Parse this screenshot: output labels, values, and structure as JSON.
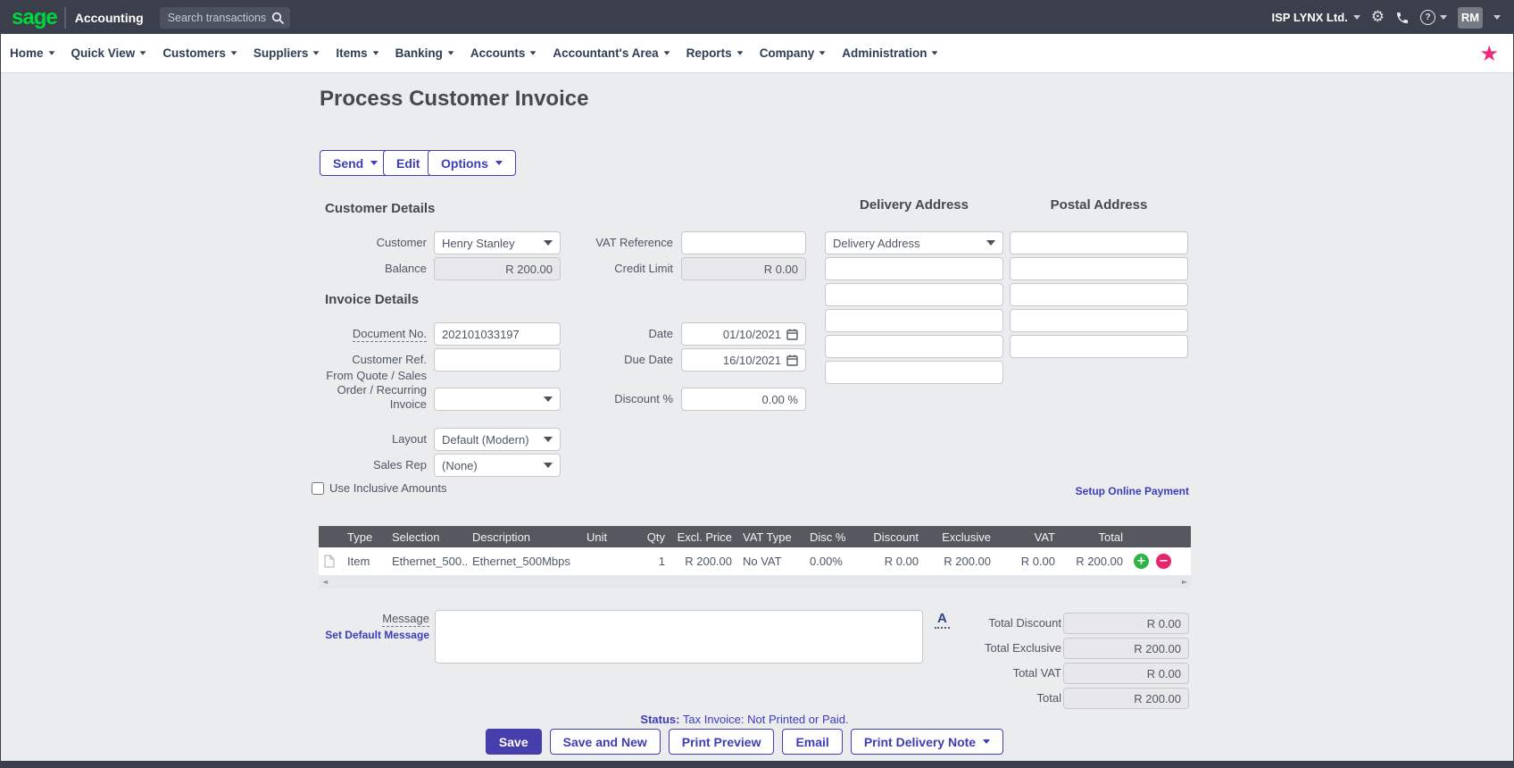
{
  "topbar": {
    "logo": "sage",
    "product": "Accounting",
    "search_placeholder": "Search transactions",
    "company": "ISP LYNX Ltd.",
    "user_initials": "RM"
  },
  "nav": {
    "items": [
      {
        "label": "Home"
      },
      {
        "label": "Quick View"
      },
      {
        "label": "Customers"
      },
      {
        "label": "Suppliers"
      },
      {
        "label": "Items"
      },
      {
        "label": "Banking"
      },
      {
        "label": "Accounts"
      },
      {
        "label": "Accountant's Area"
      },
      {
        "label": "Reports"
      },
      {
        "label": "Company"
      },
      {
        "label": "Administration"
      }
    ]
  },
  "page": {
    "title": "Process Customer Invoice"
  },
  "toolbar": {
    "send": "Send",
    "edit": "Edit",
    "options": "Options"
  },
  "customer_details": {
    "heading": "Customer Details",
    "customer_label": "Customer",
    "customer_value": "Henry Stanley",
    "balance_label": "Balance",
    "balance_value": "R 200.00",
    "vat_reference_label": "VAT Reference",
    "vat_reference_value": "",
    "credit_limit_label": "Credit Limit",
    "credit_limit_value": "R 0.00"
  },
  "addresses": {
    "delivery_heading": "Delivery Address",
    "postal_heading": "Postal Address",
    "delivery_type_value": "Delivery Address"
  },
  "invoice_details": {
    "heading": "Invoice Details",
    "document_no_label": "Document No.",
    "document_no_value": "202101033197",
    "customer_ref_label": "Customer Ref.",
    "customer_ref_value": "",
    "from_quote_label": "From Quote / Sales Order / Recurring Invoice",
    "from_quote_value": "",
    "layout_label": "Layout",
    "layout_value": "Default (Modern)",
    "sales_rep_label": "Sales Rep",
    "sales_rep_value": "(None)",
    "date_label": "Date",
    "date_value": "01/10/2021",
    "due_date_label": "Due Date",
    "due_date_value": "16/10/2021",
    "discount_label": "Discount %",
    "discount_value": "0.00 %"
  },
  "flags": {
    "use_inclusive_label": "Use Inclusive Amounts",
    "use_inclusive_checked": false,
    "setup_online_payment_link": "Setup Online Payment"
  },
  "line_items": {
    "columns": [
      "Type",
      "Selection",
      "Description",
      "Unit",
      "Qty",
      "Excl. Price",
      "VAT Type",
      "Disc %",
      "Discount",
      "Exclusive",
      "VAT",
      "Total"
    ],
    "rows": [
      {
        "type": "Item",
        "selection": "Ethernet_500...",
        "description": "Ethernet_500Mbps",
        "unit": "",
        "qty": "1",
        "excl_price": "R 200.00",
        "vat_type": "No VAT",
        "disc_pct": "0.00%",
        "discount": "R 0.00",
        "exclusive": "R 200.00",
        "vat": "R 0.00",
        "total": "R 200.00"
      }
    ]
  },
  "message": {
    "label": "Message",
    "set_default_link": "Set Default Message",
    "value": "",
    "font_button": "A"
  },
  "totals": {
    "rows": [
      {
        "label": "Total Discount",
        "value": "R 0.00"
      },
      {
        "label": "Total Exclusive",
        "value": "R 200.00"
      },
      {
        "label": "Total VAT",
        "value": "R 0.00"
      },
      {
        "label": "Total",
        "value": "R 200.00"
      }
    ]
  },
  "status": {
    "label": "Status:",
    "text": "Tax Invoice: Not Printed or Paid."
  },
  "actions": {
    "save": "Save",
    "save_and_new": "Save and New",
    "print_preview": "Print Preview",
    "email": "Email",
    "print_delivery_note": "Print Delivery Note"
  },
  "icons": {
    "star": "★",
    "gear": "⚙",
    "help": "?",
    "plus": "+",
    "minus": "−",
    "scroll_left": "◄",
    "scroll_right": "►"
  },
  "colors": {
    "topbar_bg": "#3a3f4b",
    "brand_green": "#00d639",
    "accent": "#3d3db5",
    "star_pink": "#ee2a7b",
    "table_header_bg": "#56575f",
    "add_green": "#2db543",
    "remove_red": "#e8246d",
    "page_bg": "#ebeced"
  }
}
